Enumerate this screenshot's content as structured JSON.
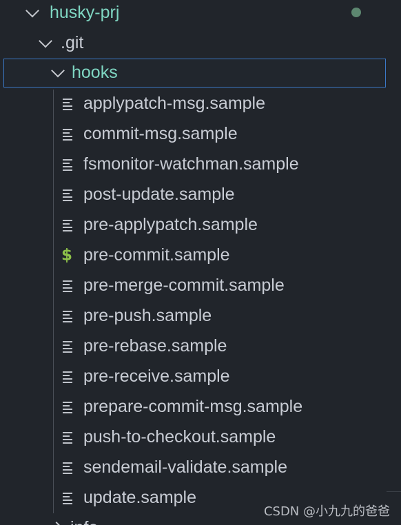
{
  "explorer": {
    "root": {
      "label": "husky-prj",
      "expanded": true,
      "modified_dot_color": "#5d8770"
    },
    "git_folder": {
      "label": ".git",
      "expanded": true
    },
    "hooks_folder": {
      "label": "hooks",
      "expanded": true,
      "selected": true
    },
    "files": [
      {
        "label": "applypatch-msg.sample",
        "icon": "text-lines-icon"
      },
      {
        "label": "commit-msg.sample",
        "icon": "text-lines-icon"
      },
      {
        "label": "fsmonitor-watchman.sample",
        "icon": "text-lines-icon"
      },
      {
        "label": "post-update.sample",
        "icon": "text-lines-icon"
      },
      {
        "label": "pre-applypatch.sample",
        "icon": "text-lines-icon"
      },
      {
        "label": "pre-commit.sample",
        "icon": "dollar-shell-icon",
        "icon_glyph": "$"
      },
      {
        "label": "pre-merge-commit.sample",
        "icon": "text-lines-icon"
      },
      {
        "label": "pre-push.sample",
        "icon": "text-lines-icon"
      },
      {
        "label": "pre-rebase.sample",
        "icon": "text-lines-icon"
      },
      {
        "label": "pre-receive.sample",
        "icon": "text-lines-icon"
      },
      {
        "label": "prepare-commit-msg.sample",
        "icon": "text-lines-icon"
      },
      {
        "label": "push-to-checkout.sample",
        "icon": "text-lines-icon"
      },
      {
        "label": "sendemail-validate.sample",
        "icon": "text-lines-icon"
      },
      {
        "label": "update.sample",
        "icon": "text-lines-icon"
      }
    ],
    "info_folder": {
      "label": "info",
      "expanded": false
    }
  },
  "watermark": {
    "text": "CSDN @小九九的爸爸"
  },
  "colors": {
    "background": "#21252b",
    "open_folder_text": "#7fd6c2",
    "selection_border": "#3b78c6",
    "shell_icon": "#8dc149"
  }
}
